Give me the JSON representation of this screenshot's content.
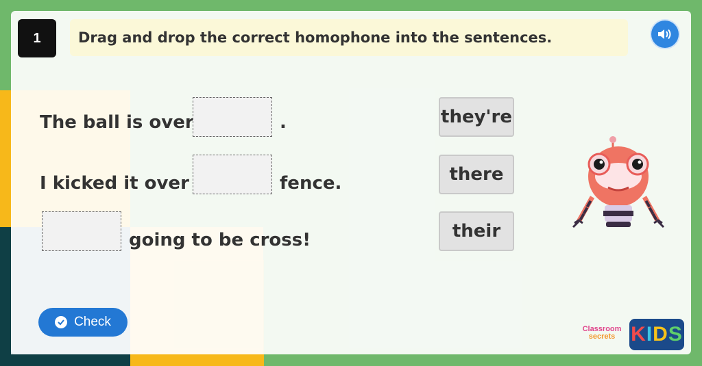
{
  "question": {
    "number": "1"
  },
  "instruction": "Drag and drop the correct homophone into the sentences.",
  "sentences": [
    {
      "before": "The ball is over",
      "after": "."
    },
    {
      "before": "I kicked it over",
      "after": "fence."
    },
    {
      "before": "",
      "after": "going to be cross!"
    }
  ],
  "word_tiles": [
    "they're",
    "there",
    "their"
  ],
  "check_button": {
    "label": "Check"
  },
  "branding": {
    "line1": "Classroom",
    "line2": "secrets",
    "kids": [
      "K",
      "I",
      "D",
      "S"
    ]
  },
  "colors": {
    "accent": "#2378d4",
    "instruction_bg": "#fbf8d8",
    "frame": "#6fb86b"
  },
  "icons": {
    "audio": "speaker-icon",
    "check": "checkmark-icon"
  }
}
